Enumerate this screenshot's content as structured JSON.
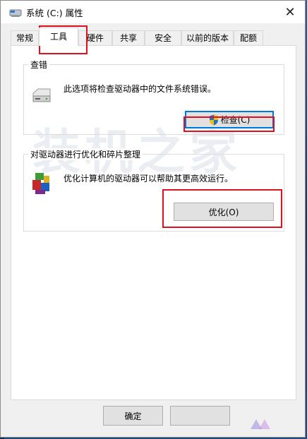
{
  "window": {
    "title": "系统 (C:) 属性",
    "close_glyph": "✕"
  },
  "tabs": [
    {
      "label": "常规"
    },
    {
      "label": "工具"
    },
    {
      "label": "硬件"
    },
    {
      "label": "共享"
    },
    {
      "label": "安全"
    },
    {
      "label": "以前的版本"
    },
    {
      "label": "配额"
    }
  ],
  "active_tab": "工具",
  "error_check": {
    "group_label": "查错",
    "description": "此选项将检查驱动器中的文件系统错误。",
    "button_label": "检查(C)"
  },
  "optimize": {
    "group_label": "对驱动器进行优化和碎片整理",
    "description": "优化计算机的驱动器可以帮助其更高效运行。",
    "button_label": "优化(O)"
  },
  "footer": {
    "ok_label": "确定"
  },
  "watermark": {
    "text": "装机之家"
  },
  "colors": {
    "highlight_red": "#e0101e",
    "focus_blue": "#0078d7",
    "shield_blue": "#1f6fd0",
    "shield_yellow": "#f2c200"
  },
  "icons": [
    "drive-icon",
    "shield-icon",
    "defrag-icon",
    "close-icon",
    "system-drive-icon"
  ]
}
